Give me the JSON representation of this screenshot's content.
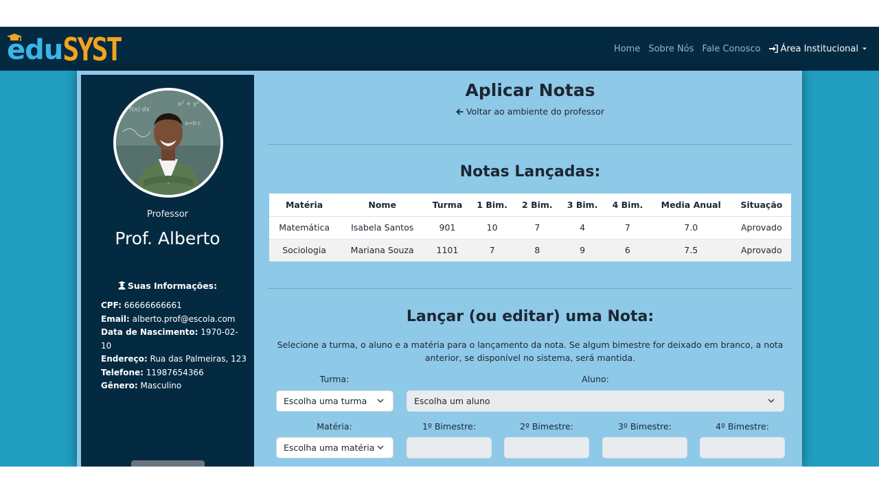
{
  "navbar": {
    "logo_edu": "edu",
    "logo_syst": "SYST",
    "links": [
      "Home",
      "Sobre Nós",
      "Fale Conosco"
    ],
    "institutional": "Área Institucional"
  },
  "sidebar": {
    "role": "Professor",
    "name": "Prof. Alberto",
    "info_title": "Suas Informações:",
    "info": [
      {
        "label": "CPF:",
        "value": "66666666661"
      },
      {
        "label": "Email:",
        "value": "alberto.prof@escola.com"
      },
      {
        "label": "Data de Nascimento:",
        "value": "1970-02-10"
      },
      {
        "label": "Endereço:",
        "value": "Rua das Palmeiras, 123"
      },
      {
        "label": "Telefone:",
        "value": "11987654366"
      },
      {
        "label": "Gênero:",
        "value": "Masculino"
      }
    ]
  },
  "main": {
    "title": "Aplicar Notas",
    "back_link": "Voltar ao ambiente do professor",
    "grades_title": "Notas Lançadas:",
    "table": {
      "headers": [
        "Matéria",
        "Nome",
        "Turma",
        "1 Bim.",
        "2 Bim.",
        "3 Bim.",
        "4 Bim.",
        "Media Anual",
        "Situação"
      ],
      "rows": [
        [
          "Matemática",
          "Isabela Santos",
          "901",
          "10",
          "7",
          "4",
          "7",
          "7.0",
          "Aprovado"
        ],
        [
          "Sociologia",
          "Mariana Souza",
          "1101",
          "7",
          "8",
          "9",
          "6",
          "7.5",
          "Aprovado"
        ]
      ]
    },
    "form": {
      "title": "Lançar (ou editar) uma Nota:",
      "description": "Selecione a turma, o aluno e a matéria para o lançamento da nota. Se algum bimestre for deixado em branco, a nota anterior, se disponível no sistema, será mantida.",
      "turma_label": "Turma:",
      "turma_value": "Escolha uma turma",
      "aluno_label": "Aluno:",
      "aluno_value": "Escolha um aluno",
      "materia_label": "Matéria:",
      "materia_value": "Escolha uma matéria",
      "bim1_label": "1º Bimestre:",
      "bim2_label": "2º Bimestre:",
      "bim3_label": "3º Bimestre:",
      "bim4_label": "4º Bimestre:"
    }
  },
  "colors": {
    "navbar": "#042a41",
    "page_bg": "#219dbf",
    "panel": "#8ec9e8",
    "logo_edu": "#3cb4e6",
    "logo_syst": "#f2a41f"
  }
}
